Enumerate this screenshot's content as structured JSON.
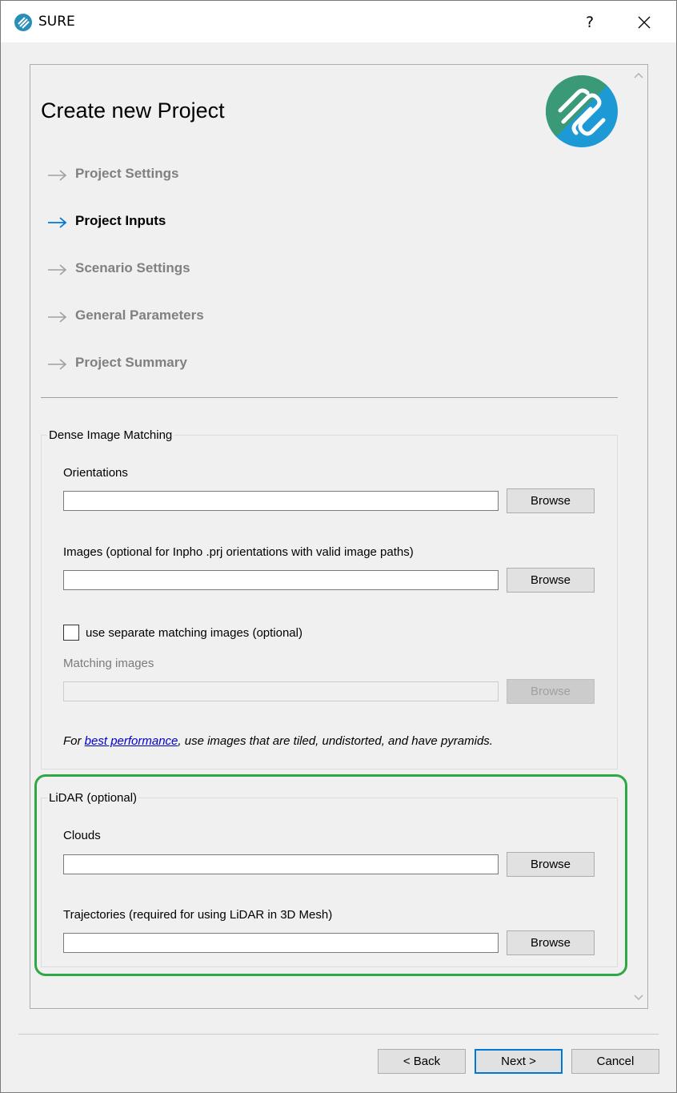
{
  "window": {
    "title": "SURE",
    "help_label": "?"
  },
  "page": {
    "title": "Create new Project"
  },
  "steps": [
    {
      "label": "Project Settings",
      "state": "inactive"
    },
    {
      "label": "Project Inputs",
      "state": "active"
    },
    {
      "label": "Scenario Settings",
      "state": "inactive"
    },
    {
      "label": "General Parameters",
      "state": "inactive"
    },
    {
      "label": "Project Summary",
      "state": "inactive"
    }
  ],
  "dense_matching": {
    "title": "Dense Image Matching",
    "orientations_label": "Orientations",
    "orientations_value": "",
    "images_label": "Images (optional for Inpho .prj orientations with valid image paths)",
    "images_value": "",
    "separate_checkbox_label": "use separate matching images (optional)",
    "separate_checked": false,
    "matching_images_label": "Matching images",
    "matching_images_value": "",
    "hint_prefix": "For ",
    "hint_link": "best performance",
    "hint_suffix": ", use images that are tiled, undistorted, and have pyramids."
  },
  "lidar": {
    "title": "LiDAR (optional)",
    "clouds_label": "Clouds",
    "clouds_value": "",
    "trajectories_label": "Trajectories (required for using LiDAR in 3D Mesh)",
    "trajectories_value": ""
  },
  "buttons": {
    "browse": "Browse",
    "back": "< Back",
    "next": "Next >",
    "cancel": "Cancel"
  },
  "colors": {
    "active_arrow": "#0078d7",
    "inactive_arrow": "#a0a0a0",
    "highlight": "#2ea844",
    "logo_green": "#3a9a78",
    "logo_blue": "#1d9ad6"
  }
}
